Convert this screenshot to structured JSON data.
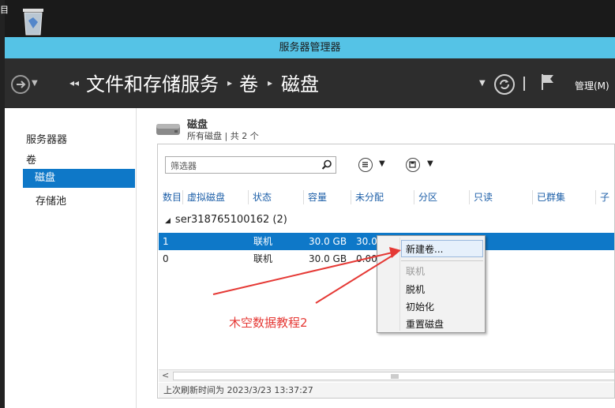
{
  "desktop": {
    "edge_text": "目"
  },
  "window": {
    "title": "服务器管理器"
  },
  "nav": {
    "breadcrumb": [
      "文件和存储服务",
      "卷",
      "磁盘"
    ],
    "manage_label": "管理(M)"
  },
  "sidebar": {
    "items": [
      {
        "label": "服务器器",
        "active": false
      },
      {
        "label": "卷",
        "active": false
      },
      {
        "label": "磁盘",
        "active": true
      },
      {
        "label": "存储池",
        "active": false
      }
    ]
  },
  "disks": {
    "title": "磁盘",
    "subtitle": "所有磁盘 | 共 2 个",
    "filter_placeholder": "筛选器",
    "columns": [
      "数目",
      "虚拟磁盘",
      "状态",
      "容量",
      "未分配",
      "分区",
      "只读",
      "已群集",
      "子"
    ],
    "group": "ser318765100162 (2)",
    "rows": [
      {
        "num": "1",
        "status": "联机",
        "capacity": "30.0 GB",
        "unallocated": "30.0",
        "selected": true
      },
      {
        "num": "0",
        "status": "联机",
        "capacity": "30.0 GB",
        "unallocated": "0.00",
        "selected": false
      }
    ],
    "status_bar": "上次刷新时间为 2023/3/23 13:37:27"
  },
  "context_menu": {
    "items": [
      {
        "label": "新建卷...",
        "enabled": true,
        "highlighted": true
      },
      {
        "label": "联机",
        "enabled": false,
        "highlighted": false
      },
      {
        "label": "脱机",
        "enabled": true,
        "highlighted": false
      },
      {
        "label": "初始化",
        "enabled": true,
        "highlighted": false
      },
      {
        "label": "重置磁盘",
        "enabled": true,
        "highlighted": false
      }
    ]
  },
  "annotation": {
    "text": "木空数据教程2",
    "color": "#e53935"
  },
  "colors": {
    "accent": "#0e78c8",
    "titlebar": "#55c3e6",
    "navbar": "#2d2d2d"
  }
}
